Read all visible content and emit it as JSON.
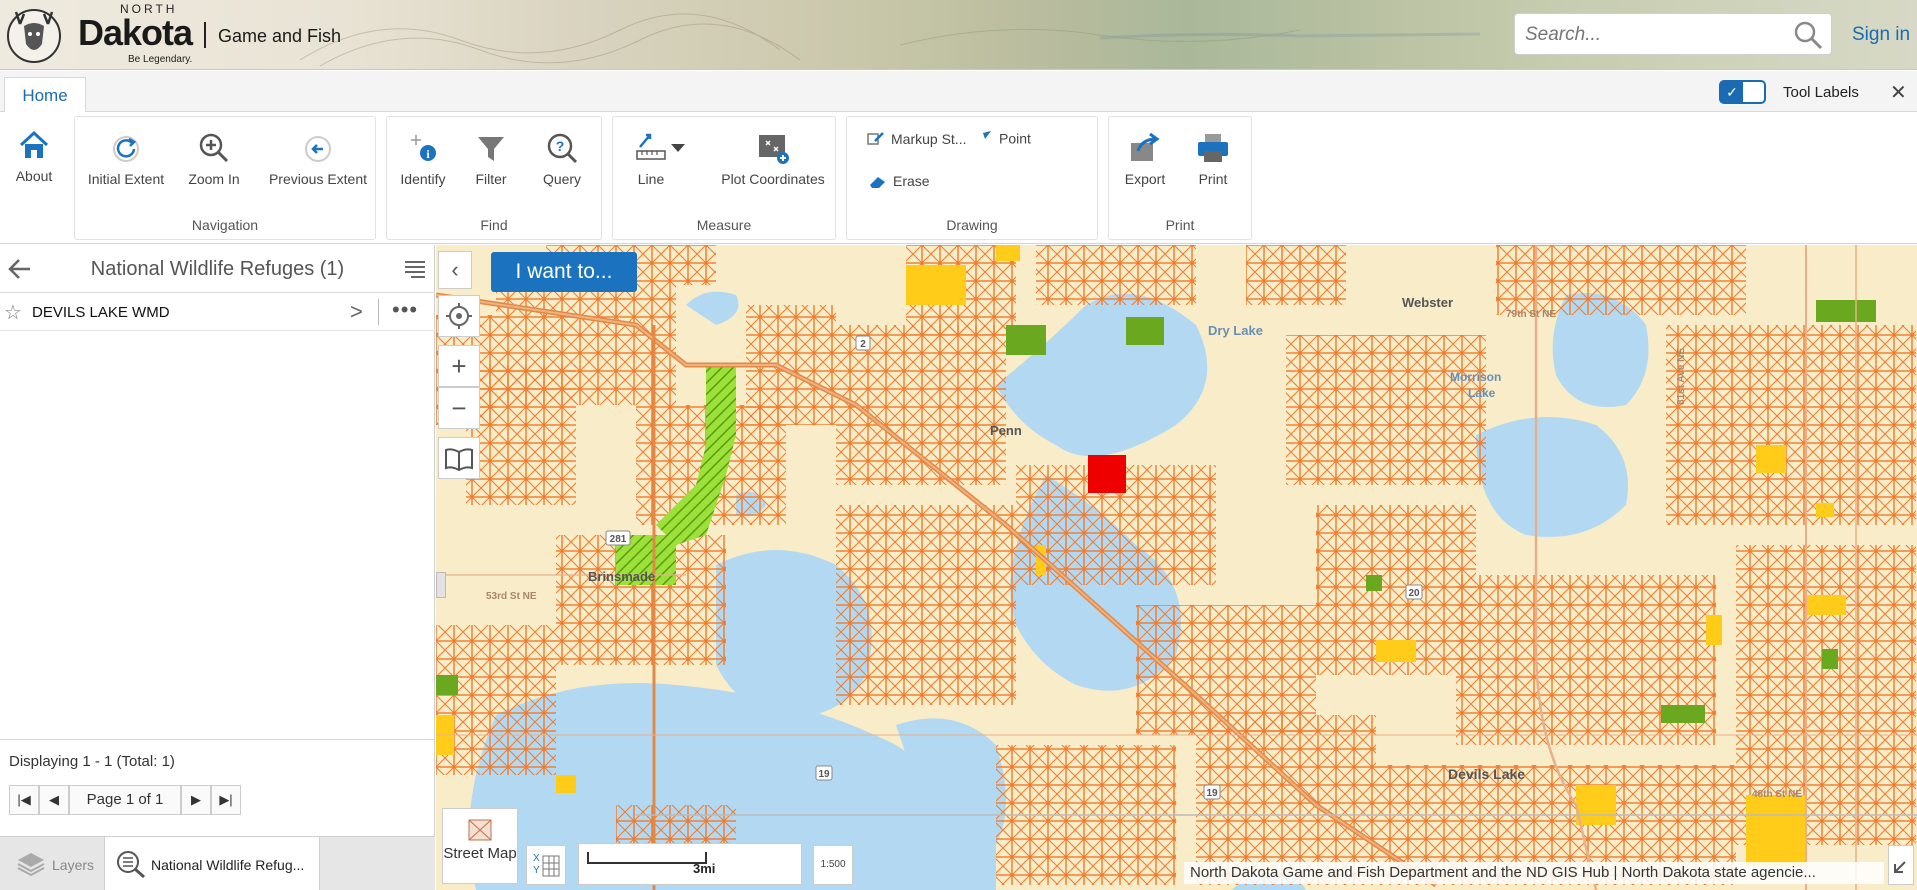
{
  "header": {
    "logo_north": "NORTH",
    "logo_dakota": "Dakota",
    "logo_game_fish": "Game and Fish",
    "logo_tagline": "Be Legendary.",
    "search_placeholder": "Search...",
    "sign_in": "Sign in"
  },
  "tabs": {
    "home": "Home",
    "tool_labels": "Tool Labels",
    "tool_labels_checked": true
  },
  "ribbon": {
    "about": "About",
    "navigation": {
      "label": "Navigation",
      "initial_extent": "Initial Extent",
      "zoom_in": "Zoom In",
      "previous_extent": "Previous Extent"
    },
    "find": {
      "label": "Find",
      "identify": "Identify",
      "filter": "Filter",
      "query": "Query"
    },
    "measure": {
      "label": "Measure",
      "line": "Line",
      "plot_coordinates": "Plot Coordinates"
    },
    "drawing": {
      "label": "Drawing",
      "markup_styles": "Markup St...",
      "point": "Point",
      "erase": "Erase"
    },
    "print": {
      "label": "Print",
      "export": "Export",
      "print": "Print"
    }
  },
  "panel": {
    "title": "National Wildlife Refuges (1)",
    "results": [
      {
        "name": "DEVILS LAKE WMD"
      }
    ],
    "displaying": "Displaying 1 - 1 (Total: 1)",
    "page_label": "Page 1 of 1",
    "tab_layers": "Layers",
    "tab_results": "National Wildlife Refug..."
  },
  "map": {
    "i_want_to": "I want to...",
    "basemap_label": "Street Map",
    "scale_label": "3mi",
    "scale_input": "1:500",
    "attribution": "North Dakota Game and Fish Department and the ND GIS Hub | North Dakota state agencie...",
    "place_labels": {
      "webster": "Webster",
      "dry_lake": "Dry Lake",
      "morrison_lake_1": "Morrison",
      "morrison_lake_2": "Lake",
      "penn": "Penn",
      "brinsmade": "Brinsmade",
      "devils_lake": "Devils Lake",
      "rd_53": "53rd St NE",
      "rd_79": "79th St NE",
      "rd_48": "48th St NE",
      "rd_81ave": "81st Ave NE",
      "hwy_281": "281",
      "hwy_20": "20",
      "hwy_19": "19",
      "hwy_19b": "19",
      "hwy_2": "2"
    }
  },
  "colors": {
    "accent": "#1b73c0",
    "map_land": "#f8ecc9",
    "map_water": "#b3d9f2",
    "parcel_orange": "#f07a2a",
    "refuge_red": "#ee0000",
    "plots_yellow": "#ffcc1a",
    "wma_green": "#8fd336"
  }
}
